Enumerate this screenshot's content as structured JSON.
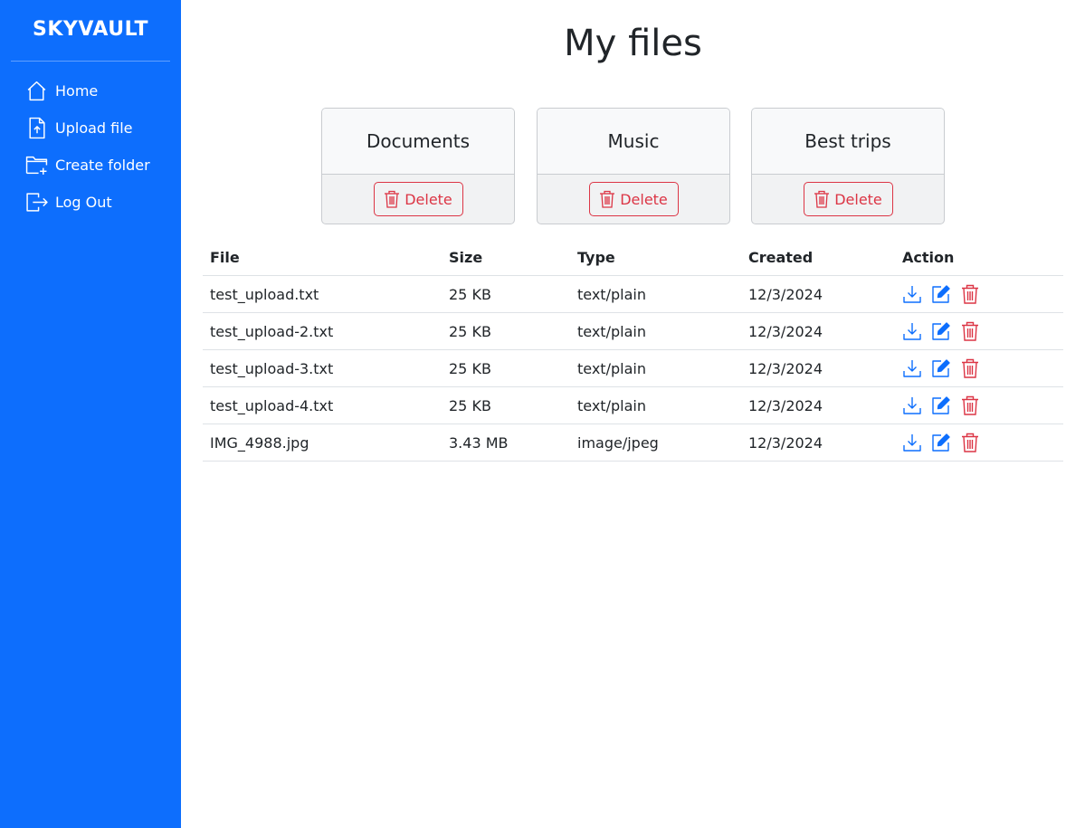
{
  "app": {
    "brand": "SKYVAULT"
  },
  "sidebar": {
    "items": [
      {
        "label": "Home",
        "icon": "house-icon"
      },
      {
        "label": "Upload file",
        "icon": "file-upload-icon"
      },
      {
        "label": "Create folder",
        "icon": "folder-plus-icon"
      },
      {
        "label": "Log Out",
        "icon": "logout-icon"
      }
    ]
  },
  "main": {
    "title": "My files",
    "folders": [
      {
        "name": "Documents",
        "delete_label": "Delete"
      },
      {
        "name": "Music",
        "delete_label": "Delete"
      },
      {
        "name": "Best trips",
        "delete_label": "Delete"
      }
    ],
    "table": {
      "headers": [
        "File",
        "Size",
        "Type",
        "Created",
        "Action"
      ],
      "rows": [
        {
          "file": "test_upload.txt",
          "size": "25 KB",
          "type": "text/plain",
          "created": "12/3/2024"
        },
        {
          "file": "test_upload-2.txt",
          "size": "25 KB",
          "type": "text/plain",
          "created": "12/3/2024"
        },
        {
          "file": "test_upload-3.txt",
          "size": "25 KB",
          "type": "text/plain",
          "created": "12/3/2024"
        },
        {
          "file": "test_upload-4.txt",
          "size": "25 KB",
          "type": "text/plain",
          "created": "12/3/2024"
        },
        {
          "file": "IMG_4988.jpg",
          "size": "3.43 MB",
          "type": "image/jpeg",
          "created": "12/3/2024"
        }
      ],
      "action_icons": [
        "download-icon",
        "edit-icon",
        "trash-icon"
      ]
    }
  },
  "colors": {
    "primary": "#0d6efd",
    "danger": "#dc3545",
    "text": "#212529"
  }
}
